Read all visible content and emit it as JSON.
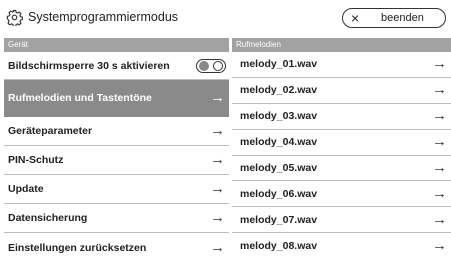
{
  "header": {
    "title": "Systemprogrammiermodus",
    "exit_label": "beenden",
    "icon": "gear-icon"
  },
  "device": {
    "section_label": "Gerät",
    "screenlock_label": "Bildschirmsperre 30 s aktivieren",
    "screenlock_on": false,
    "items": [
      {
        "label": "Rufmelodien und Tastentöne",
        "selected": true
      },
      {
        "label": "Geräteparameter",
        "selected": false
      },
      {
        "label": "PIN-Schutz",
        "selected": false
      },
      {
        "label": "Update",
        "selected": false
      },
      {
        "label": "Datensicherung",
        "selected": false
      },
      {
        "label": "Einstellungen zurücksetzen",
        "selected": false
      }
    ]
  },
  "ringtones": {
    "section_label": "Rufmelodien",
    "items": [
      "melody_01.wav",
      "melody_02.wav",
      "melody_03.wav",
      "melody_04.wav",
      "melody_05.wav",
      "melody_06.wav",
      "melody_07.wav",
      "melody_08.wav"
    ]
  },
  "arrow_glyph": "→",
  "colors": {
    "section_header": "#a2a2a2",
    "selected_row": "#8a8a8a",
    "divider": "#bdbdbd"
  }
}
